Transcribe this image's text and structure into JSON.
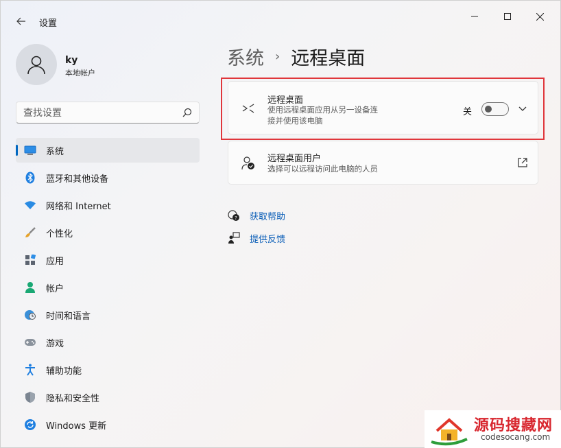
{
  "titlebar": {
    "app_title": "设置"
  },
  "profile": {
    "username": "ky",
    "account_type": "本地帐户"
  },
  "search": {
    "placeholder": "查找设置"
  },
  "sidebar": {
    "items": [
      {
        "label": "系统",
        "icon": "monitor-icon",
        "selected": true
      },
      {
        "label": "蓝牙和其他设备",
        "icon": "bluetooth-icon"
      },
      {
        "label": "网络和 Internet",
        "icon": "wifi-icon"
      },
      {
        "label": "个性化",
        "icon": "brush-icon"
      },
      {
        "label": "应用",
        "icon": "apps-icon"
      },
      {
        "label": "帐户",
        "icon": "person-icon"
      },
      {
        "label": "时间和语言",
        "icon": "globe-clock-icon"
      },
      {
        "label": "游戏",
        "icon": "gamepad-icon"
      },
      {
        "label": "辅助功能",
        "icon": "accessibility-icon"
      },
      {
        "label": "隐私和安全性",
        "icon": "shield-icon"
      },
      {
        "label": "Windows 更新",
        "icon": "update-icon"
      }
    ]
  },
  "main": {
    "breadcrumb_parent": "系统",
    "breadcrumb_separator": "›",
    "breadcrumb_current": "远程桌面",
    "rdp_card": {
      "title": "远程桌面",
      "description_line1": "使用远程桌面应用从另一设备连",
      "description_line2": "接并使用该电脑",
      "toggle_label": "关",
      "toggle_on": false
    },
    "users_card": {
      "title": "远程桌面用户",
      "description": "选择可以远程访问此电脑的人员"
    },
    "links": {
      "help": "获取帮助",
      "feedback": "提供反馈"
    }
  },
  "watermark": {
    "title": "源码搜藏网",
    "url": "codesocang.com"
  },
  "colors": {
    "accent": "#0067c0",
    "link": "#0a5eb7",
    "highlight_border": "#e0363b"
  }
}
